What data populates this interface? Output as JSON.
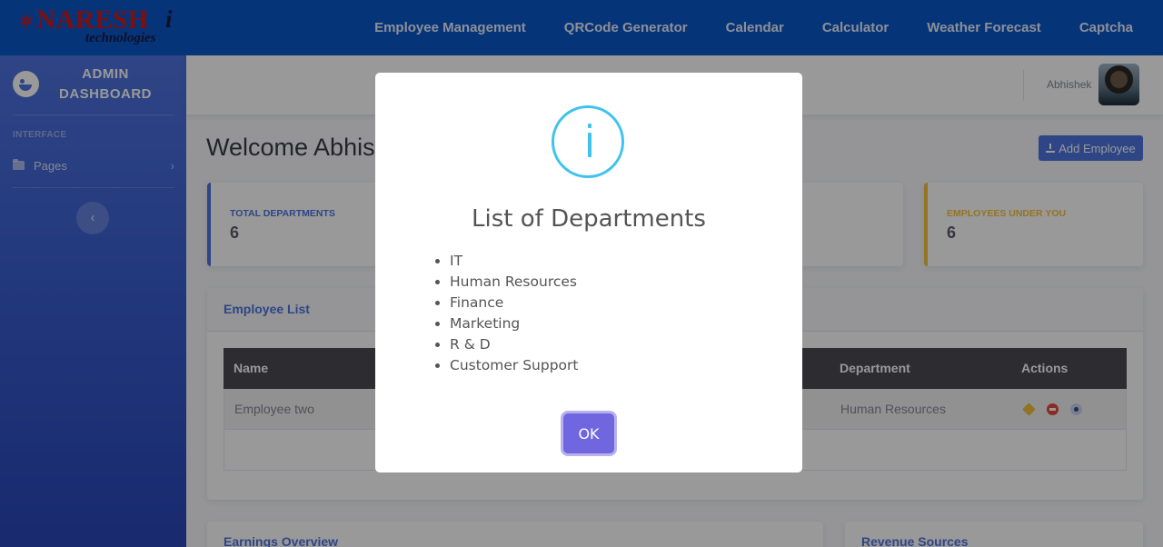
{
  "nav": {
    "logo_brand": "NARESH",
    "logo_brand_suffix": "i",
    "logo_tagline": "technologies",
    "links": [
      "Employee Management",
      "QRCode Generator",
      "Calendar",
      "Calculator",
      "Weather Forecast",
      "Captcha"
    ]
  },
  "sidebar": {
    "title_line1": "ADMIN",
    "title_line2": "DASHBOARD",
    "section_heading": "INTERFACE",
    "items": [
      {
        "label": "Pages"
      }
    ]
  },
  "topbar": {
    "username": "Abhishek"
  },
  "main": {
    "welcome": "Welcome Abhis",
    "add_button": "Add Employee",
    "stats": [
      {
        "label": "TOTAL DEPARTMENTS",
        "value": "6"
      },
      {
        "label": "EMPLOYEES UNDER YOU",
        "value": "6"
      }
    ],
    "employee_list": {
      "title": "Employee List",
      "columns": [
        "Name",
        "Department",
        "Actions"
      ],
      "rows": [
        {
          "name": "Employee two",
          "department": "Human Resources"
        }
      ]
    },
    "earnings_title": "Earnings Overview",
    "revenue_title": "Revenue Sources"
  },
  "modal": {
    "title": "List of Departments",
    "departments": [
      "IT",
      "Human Resources",
      "Finance",
      "Marketing",
      "R & D",
      "Customer Support"
    ],
    "ok_label": "OK"
  },
  "colors": {
    "primary": "#4e73df",
    "warning": "#f6c23e",
    "info_icon": "#3fc3ee",
    "ok_button": "#7066e0",
    "nav": "#0a58ca"
  }
}
